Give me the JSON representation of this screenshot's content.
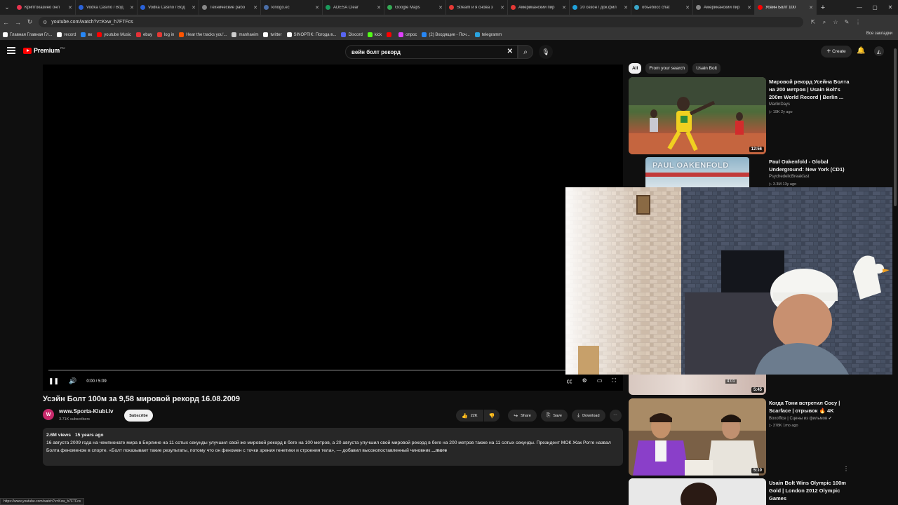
{
  "browser": {
    "tabs": [
      {
        "label": "Криптоказино онл",
        "color": "#e8344f"
      },
      {
        "label": "Vodka Casino / Вод",
        "color": "#2a62d8"
      },
      {
        "label": "Vodka Casino / Вод",
        "color": "#2a62d8"
      },
      {
        "label": "Технические рабо",
        "color": "#888888"
      },
      {
        "label": "kinogo.ec",
        "color": "#4a6ea8"
      },
      {
        "label": "ADESA Clear",
        "color": "#1a9a5c"
      },
      {
        "label": "Google Maps",
        "color": "#34a853"
      },
      {
        "label": "Stream и я снова з",
        "color": "#e53935"
      },
      {
        "label": "Американский пир",
        "color": "#e53935"
      },
      {
        "label": "20 сезон / док.фил",
        "color": "#1fa0d8"
      },
      {
        "label": "объебосс chat",
        "color": "#3aa6c9"
      },
      {
        "label": "Американский пир",
        "color": "#888888"
      },
      {
        "label": "Усейн Болт 100",
        "color": "#ff0000"
      }
    ],
    "url": "youtube.com/watch?v=Kxw_h7FTFcs",
    "bookmarks": [
      {
        "label": "Главная Главная Гл...",
        "color": "#ffffff"
      },
      {
        "label": "record",
        "color": "#ffffff"
      },
      {
        "label": "вк",
        "color": "#2787f5"
      },
      {
        "label": "youtube Music",
        "color": "#ff0000"
      },
      {
        "label": "ebay",
        "color": "#e53238"
      },
      {
        "label": "log in",
        "color": "#e53935"
      },
      {
        "label": "Hear the tracks you'...",
        "color": "#ff5500"
      },
      {
        "label": "manhaeim",
        "color": "#cccccc"
      },
      {
        "label": "twitter",
        "color": "#ffffff"
      },
      {
        "label": "SINOPTIK: Погода в...",
        "color": "#ffffff"
      },
      {
        "label": "Discord",
        "color": "#5865f2"
      },
      {
        "label": "kick",
        "color": "#53fc18"
      },
      {
        "label": "",
        "color": "#ff0000"
      },
      {
        "label": "опрос",
        "color": "#e040fb"
      },
      {
        "label": "(2) Входящие - Поч...",
        "color": "#2787f5"
      },
      {
        "label": "telegramm",
        "color": "#2aa3df"
      }
    ],
    "all_bookmarks": "Все закладки",
    "status_url": "https://www.youtube.com/watch?v=Kxw_h7FTFcs"
  },
  "yt": {
    "logo": "Premium",
    "country": "RU",
    "search_query": "вейн болт рекорд",
    "create_label": "Create"
  },
  "player": {
    "time": "0:00 / 5:09",
    "progress": 0.0
  },
  "video": {
    "title": "Усэйн Болт 100м за 9,58 мировой рекорд 16.08.2009",
    "channel": "www.Sporta-Klubi.lv",
    "channel_initial": "W",
    "subscribers": "3.71K subscribers",
    "subscribe": "Subscribe",
    "likes": "22K",
    "share": "Share",
    "save": "Save",
    "download": "Download",
    "views": "2.6M views",
    "age": "15 years ago",
    "description": "16 августа 2009 года на чемпионате мира в Берлине на 11 сотых секунды улучшил свой же мировой рекорд в беге на 100 метров, а 20 августа улучшил свой мировой рекорд в беге на 200 метров также на 11 сотых секунды. Президент МОК Жак Рогге назвал Болта феноменом в спорте. «Болт показывает такие результаты, потому что он феномен с точки зрения генетики и строения тела», — добавил высокопоставленный чиновник",
    "more": "...more"
  },
  "sidebar": {
    "chips": [
      "All",
      "From your search",
      "Usain Bolt"
    ],
    "items": [
      {
        "title": "Мировой рекорд Усейна Болта на 200 метров | Usain Bolt's 200m World Record | Berlin ...",
        "channel": "MarlinDays",
        "meta": "▷ 19K  2y ago",
        "duration": "12:56"
      },
      {
        "title": "Paul Oakenfold - Global Underground: New York (CD1)",
        "channel": "PsychedelicBreakfast",
        "meta": "▷ 3.3M  13y ago",
        "duration": "",
        "thumb_text": "PAUL OAKENFOLD"
      },
      {
        "title": "",
        "channel": "",
        "meta": "",
        "duration": "5:45",
        "overlay_time": "4:01"
      },
      {
        "title": "Когда Тони встретил Сосу | Scarface | отрывок 🔥 4K",
        "channel": "Boxoffice | Сцены из фильмов ✔",
        "meta": "▷ 378K  1mo ago",
        "duration": "5:10"
      },
      {
        "title": "Usain Bolt Wins Olympic 100m Gold | London 2012 Olympic Games",
        "channel": "",
        "meta": "",
        "duration": ""
      }
    ]
  },
  "colors": {
    "bg": "#0f0f0f",
    "accent": "#ff0000",
    "surface": "#272727"
  }
}
